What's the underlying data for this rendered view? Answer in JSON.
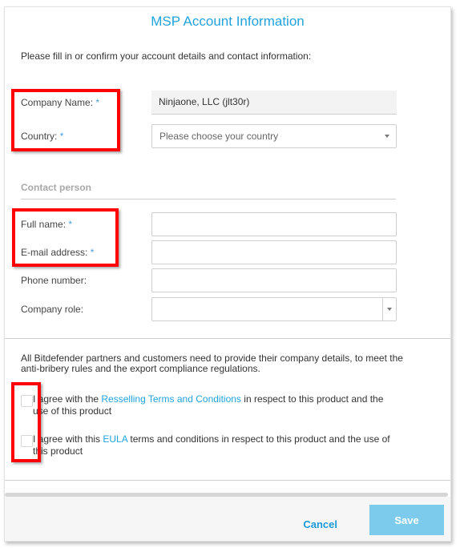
{
  "dialog": {
    "title": "MSP Account Information",
    "intro": "Please fill in or confirm your account details and contact information:",
    "company": {
      "name_label": "Company Name:",
      "name_value": "Ninjaone, LLC (jlt30r)",
      "country_label": "Country:",
      "country_placeholder": "Please choose your country",
      "required_mark": "*"
    },
    "contact": {
      "section_title": "Contact person",
      "full_name_label": "Full name:",
      "full_name_value": "",
      "email_label": "E-mail address:",
      "email_value": "",
      "phone_label": "Phone number:",
      "phone_value": "",
      "role_label": "Company role:",
      "role_value": ""
    },
    "compliance": {
      "notice": "All Bitdefender partners and customers need to provide their company details, to meet the anti-bribery rules and the export compliance regulations.",
      "agreements": [
        {
          "prefix": "I agree with the ",
          "link": "Resselling Terms and Conditions",
          "suffix": " in respect to this product and the use of this product",
          "checked": false
        },
        {
          "prefix": "I agree with this ",
          "link": "EULA",
          "suffix": " terms and conditions in respect to this product and the use of this product",
          "checked": false
        }
      ]
    },
    "footer": {
      "cancel_label": "Cancel",
      "save_label": "Save"
    }
  },
  "colors": {
    "accent": "#21a3de",
    "save_button": "#7ccbec",
    "highlight_box": "#ff0000"
  }
}
